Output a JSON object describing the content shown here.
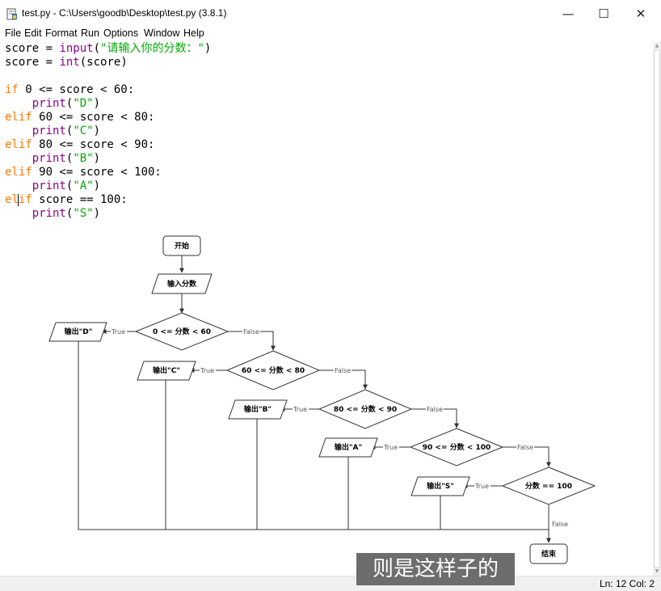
{
  "window": {
    "title": "test.py - C:\\Users\\goodb\\Desktop\\test.py (3.8.1)",
    "minimize": "—",
    "maximize": "☐",
    "close": "✕"
  },
  "menu": [
    "File",
    "Edit",
    "Format",
    "Run",
    "Options",
    "Window",
    "Help"
  ],
  "code": {
    "l1_var": "score",
    "l1_op": " = ",
    "l1_fn": "input",
    "l1_open": "(",
    "l1_str": "\"请输入你的分数：\"",
    "l1_close": ")",
    "l2_var": "score",
    "l2_op": " = ",
    "l2_fn": "int",
    "l2_rest": "(score)",
    "if_kw": "if",
    "if_cond": " 0 <= score < 60:",
    "elif_kw": "elif",
    "elif_a": "el",
    "elif_b": "if",
    "c1": " 60 <= score < 80:",
    "c2": " 80 <= score < 90:",
    "c3": " 90 <= score < 100:",
    "c4": " score == 100:",
    "indent": "    ",
    "print": "print",
    "p_open": "(",
    "p_close": ")",
    "sD": "\"D\"",
    "sC": "\"C\"",
    "sB": "\"B\"",
    "sA": "\"A\"",
    "sS": "\"S\""
  },
  "flowchart": {
    "start": "开始",
    "input": "输入分数",
    "d1": "0 <= 分数 < 60",
    "d2": "60 <= 分数 < 80",
    "d3": "80 <= 分数 < 90",
    "d4": "90 <= 分数 < 100",
    "d5": "分数 == 100",
    "oD": "输出\"D\"",
    "oC": "输出\"C\"",
    "oB": "输出\"B\"",
    "oA": "输出\"A\"",
    "oS": "输出\"S\"",
    "end": "结束",
    "true_label": "True",
    "false_label": "False"
  },
  "status": "Ln: 12  Col: 2",
  "subtitle": "则是这样子的"
}
